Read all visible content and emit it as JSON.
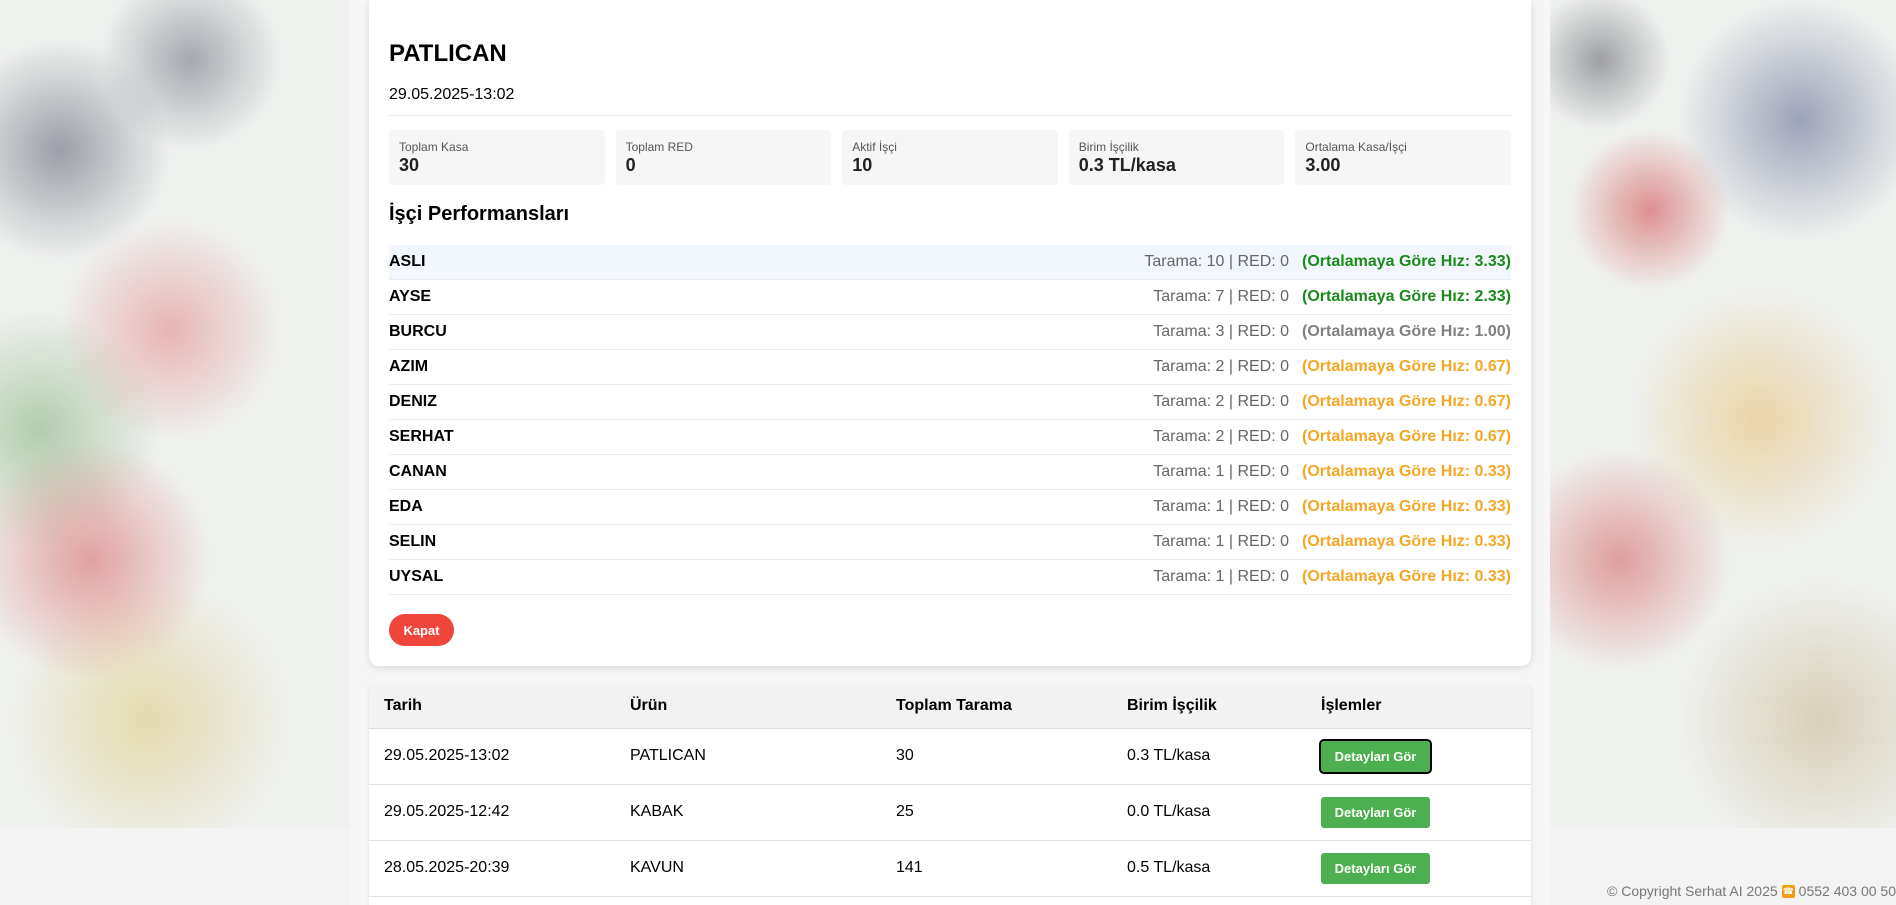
{
  "modal": {
    "title": "PATLICAN",
    "date": "29.05.2025-13:02",
    "stats": [
      {
        "label": "Toplam Kasa",
        "value": "30"
      },
      {
        "label": "Toplam RED",
        "value": "0"
      },
      {
        "label": "Aktif İşçi",
        "value": "10"
      },
      {
        "label": "Birim İşçilik",
        "value": "0.3 TL/kasa"
      },
      {
        "label": "Ortalama Kasa/İşçi",
        "value": "3.00"
      }
    ],
    "section_title": "İşçi Performansları",
    "workers": [
      {
        "name": "ASLI",
        "stats": "Tarama: 10 | RED: 0",
        "speed": "(Ortalamaya Göre Hız: 3.33)"
      },
      {
        "name": "AYSE",
        "stats": "Tarama: 7 | RED: 0",
        "speed": "(Ortalamaya Göre Hız: 2.33)"
      },
      {
        "name": "BURCU",
        "stats": "Tarama: 3 | RED: 0",
        "speed": "(Ortalamaya Göre Hız: 1.00)"
      },
      {
        "name": "AZIM",
        "stats": "Tarama: 2 | RED: 0",
        "speed": "(Ortalamaya Göre Hız: 0.67)"
      },
      {
        "name": "DENIZ",
        "stats": "Tarama: 2 | RED: 0",
        "speed": "(Ortalamaya Göre Hız: 0.67)"
      },
      {
        "name": "SERHAT",
        "stats": "Tarama: 2 | RED: 0",
        "speed": "(Ortalamaya Göre Hız: 0.67)"
      },
      {
        "name": "CANAN",
        "stats": "Tarama: 1 | RED: 0",
        "speed": "(Ortalamaya Göre Hız: 0.33)"
      },
      {
        "name": "EDA",
        "stats": "Tarama: 1 | RED: 0",
        "speed": "(Ortalamaya Göre Hız: 0.33)"
      },
      {
        "name": "SELIN",
        "stats": "Tarama: 1 | RED: 0",
        "speed": "(Ortalamaya Göre Hız: 0.33)"
      },
      {
        "name": "UYSAL",
        "stats": "Tarama: 1 | RED: 0",
        "speed": "(Ortalamaya Göre Hız: 0.33)"
      }
    ],
    "close_label": "Kapat"
  },
  "table": {
    "headers": [
      "Tarih",
      "Ürün",
      "Toplam Tarama",
      "Birim İşçilik",
      "İşlemler"
    ],
    "rows": [
      {
        "date": "29.05.2025-13:02",
        "product": "PATLICAN",
        "total": "30",
        "unit": "0.3 TL/kasa",
        "action": "Detayları Gör"
      },
      {
        "date": "29.05.2025-12:42",
        "product": "KABAK",
        "total": "25",
        "unit": "0.0 TL/kasa",
        "action": "Detayları Gör"
      },
      {
        "date": "28.05.2025-20:39",
        "product": "KAVUN",
        "total": "141",
        "unit": "0.5 TL/kasa",
        "action": "Detayları Gör"
      }
    ]
  },
  "footer": {
    "copyright": "© Copyright Serhat AI 2025",
    "phone_icon": "phone-icon",
    "phone": "0552 403 00 50"
  },
  "colors": {
    "speed_high": "#1a8a1a",
    "speed_avg": "#808080",
    "speed_low": "#f5a623",
    "close_button": "#f0453a",
    "detail_button": "#4caf50"
  }
}
